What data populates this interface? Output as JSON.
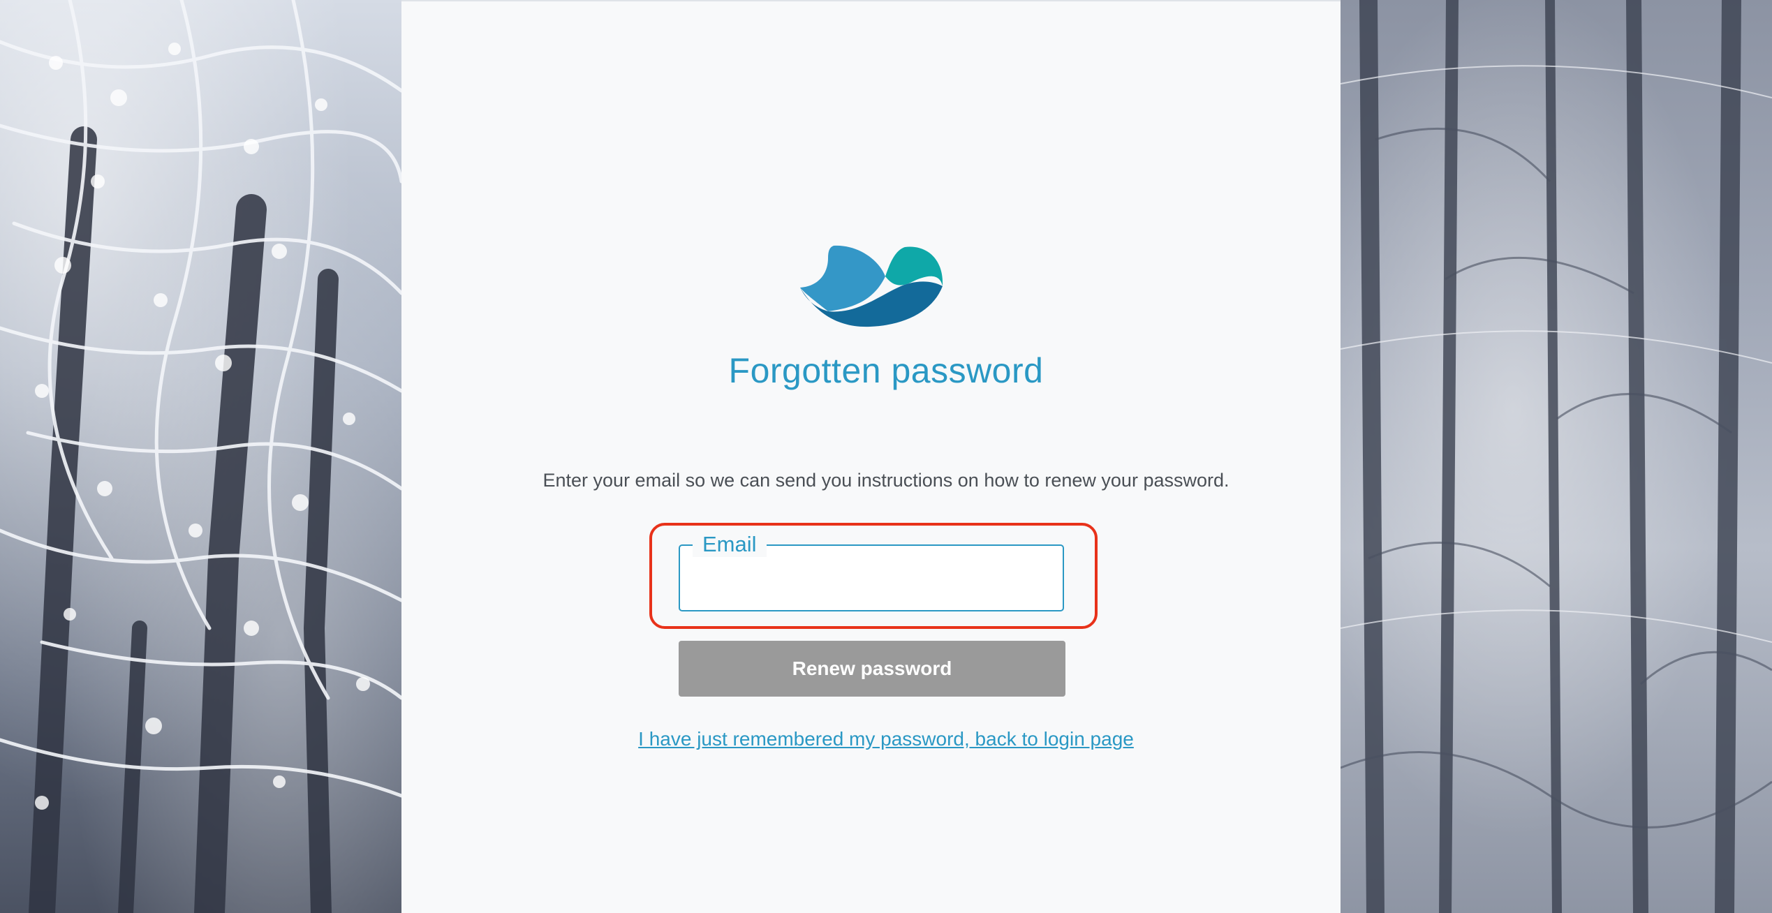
{
  "page": {
    "title": "Forgotten password",
    "instructions": "Enter your email so we can send you instructions on how to renew your password."
  },
  "form": {
    "email_label": "Email",
    "email_value": "",
    "renew_button_label": "Renew password",
    "back_link_text": "I have just remembered my password, back to login page"
  },
  "icons": {
    "logo": "manta-ray-logo-icon"
  },
  "colors": {
    "accent": "#2a98c4",
    "highlight_outline": "#e8321a",
    "button_disabled": "#9a9a9a",
    "logo_light_blue": "#3497c7",
    "logo_teal": "#0fa8a8",
    "logo_dark_blue": "#136a9a"
  }
}
